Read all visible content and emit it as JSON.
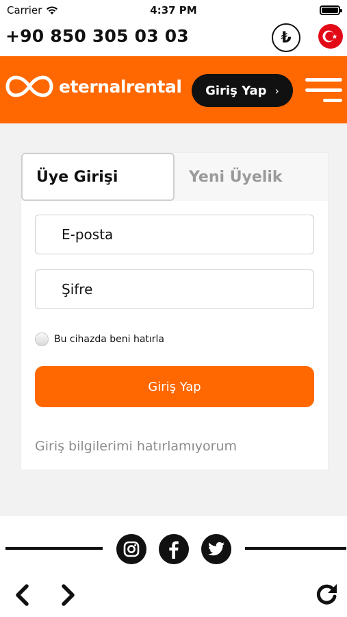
{
  "status_bar": {
    "carrier": "Carrier",
    "time": "4:37 PM"
  },
  "contact": {
    "phone": "+90 850 305 03 03",
    "currency_symbol": "₺"
  },
  "header": {
    "brand": "eternalrental",
    "login_label": "Giriş Yap",
    "login_chevron": "›"
  },
  "form": {
    "tabs": [
      {
        "label": "Üye Girişi",
        "active": true
      },
      {
        "label": "Yeni Üyelik",
        "active": false
      }
    ],
    "email_placeholder": "E-posta",
    "password_placeholder": "Şifre",
    "remember_label": "Bu cihazda beni hatırla",
    "submit_label": "Giriş Yap",
    "forgot_label": "Giriş bilgilerimi hatırlamıyorum"
  },
  "icons": [
    "wifi-icon",
    "battery-icon",
    "currency-icon",
    "flag-icon",
    "logo-mark-icon",
    "menu-icon",
    "instagram-icon",
    "facebook-icon",
    "twitter-icon",
    "back-icon",
    "forward-icon",
    "reload-icon"
  ],
  "colors": {
    "brand_orange": "#ff6700",
    "dark": "#111111",
    "flag_red": "#e30a17",
    "background": "#f2f2f2"
  }
}
